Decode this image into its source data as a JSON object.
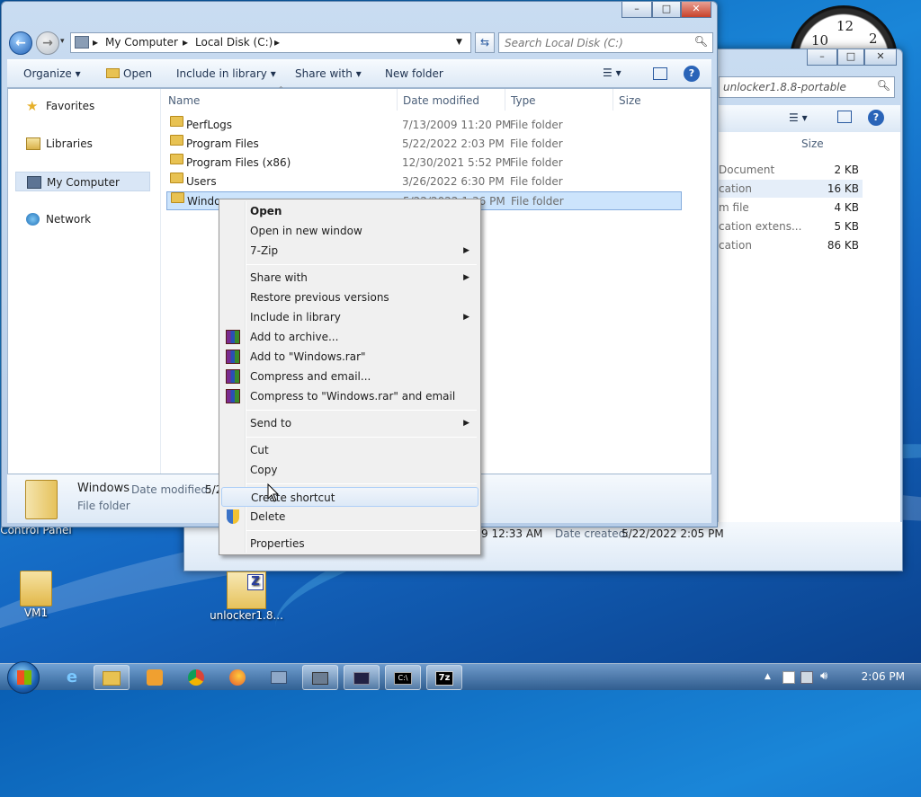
{
  "desktop": {
    "icons": [
      {
        "label": "Control Panel"
      },
      {
        "label": "VM1"
      },
      {
        "label": "unlocker1.8..."
      }
    ],
    "clock_numbers": [
      "10",
      "12",
      "2"
    ]
  },
  "window2": {
    "search_text": "unlocker1.8.8-portable",
    "header_size": "Size",
    "rows": [
      {
        "type": "Document",
        "size": "2 KB"
      },
      {
        "type": "cation",
        "size": "16 KB"
      },
      {
        "type": "m file",
        "size": "4 KB"
      },
      {
        "type": "cation extens...",
        "size": "5 KB"
      },
      {
        "type": "cation",
        "size": "86 KB"
      }
    ],
    "details": {
      "date_modified": "9 12:33 AM",
      "date_created_label": "Date created:",
      "date_created": "5/22/2022 2:05 PM"
    }
  },
  "explorer": {
    "breadcrumb": [
      "My Computer",
      "Local Disk (C:)"
    ],
    "search_placeholder": "Search Local Disk (C:)",
    "toolbar": {
      "organize": "Organize",
      "open": "Open",
      "include_in_library": "Include in library",
      "share_with": "Share with",
      "new_folder": "New folder"
    },
    "nav": [
      {
        "label": "Favorites"
      },
      {
        "label": "Libraries"
      },
      {
        "label": "My Computer"
      },
      {
        "label": "Network"
      }
    ],
    "columns": {
      "name": "Name",
      "date": "Date modified",
      "type": "Type",
      "size": "Size"
    },
    "files": [
      {
        "name": "PerfLogs",
        "date": "7/13/2009 11:20 PM",
        "type": "File folder"
      },
      {
        "name": "Program Files",
        "date": "5/22/2022 2:03 PM",
        "type": "File folder"
      },
      {
        "name": "Program Files (x86)",
        "date": "12/30/2021 5:52 PM",
        "type": "File folder"
      },
      {
        "name": "Users",
        "date": "3/26/2022 6:30 PM",
        "type": "File folder"
      },
      {
        "name": "Windows",
        "date": "5/22/2022 1:36 PM",
        "type": "File folder"
      }
    ],
    "details": {
      "name": "Windows",
      "date_label": "Date modified:",
      "date_value": "5/2",
      "type": "File folder"
    }
  },
  "context_menu": {
    "items": [
      {
        "label": "Open"
      },
      {
        "label": "Open in new window"
      },
      {
        "label": "7-Zip"
      },
      {
        "label": "Share with"
      },
      {
        "label": "Restore previous versions"
      },
      {
        "label": "Include in library"
      },
      {
        "label": "Add to archive..."
      },
      {
        "label": "Add to \"Windows.rar\""
      },
      {
        "label": "Compress and email..."
      },
      {
        "label": "Compress to \"Windows.rar\" and email"
      },
      {
        "label": "Send to"
      },
      {
        "label": "Cut"
      },
      {
        "label": "Copy"
      },
      {
        "label": "Create shortcut"
      },
      {
        "label": "Delete"
      },
      {
        "label": "Properties"
      }
    ]
  },
  "taskbar": {
    "time": "2:06 PM"
  }
}
